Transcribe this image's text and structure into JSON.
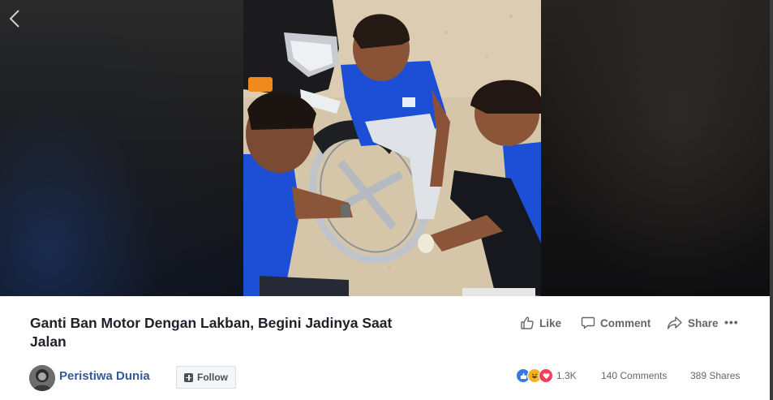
{
  "video": {
    "title": "Ganti Ban Motor Dengan Lakban, Begini Jadinya Saat Jalan"
  },
  "actions": {
    "like_label": "Like",
    "comment_label": "Comment",
    "share_label": "Share",
    "more_label": "•••"
  },
  "page": {
    "name": "Peristiwa Dunia",
    "follow_label": "Follow"
  },
  "stats": {
    "reactions_count": "1.3K",
    "comments": "140 Comments",
    "shares": "389 Shares"
  },
  "colors": {
    "link": "#385898",
    "text": "#1d2129",
    "muted": "#606770",
    "like_reaction": "#3578e5",
    "haha_reaction": "#f7b125",
    "love_reaction": "#f33e58",
    "shirt_blue": "#1c4fd6"
  },
  "icons": {
    "back": "chevron-left-icon",
    "like": "thumbs-up-icon",
    "comment": "speech-bubble-icon",
    "share": "share-arrow-icon",
    "follow": "plus-square-icon"
  }
}
